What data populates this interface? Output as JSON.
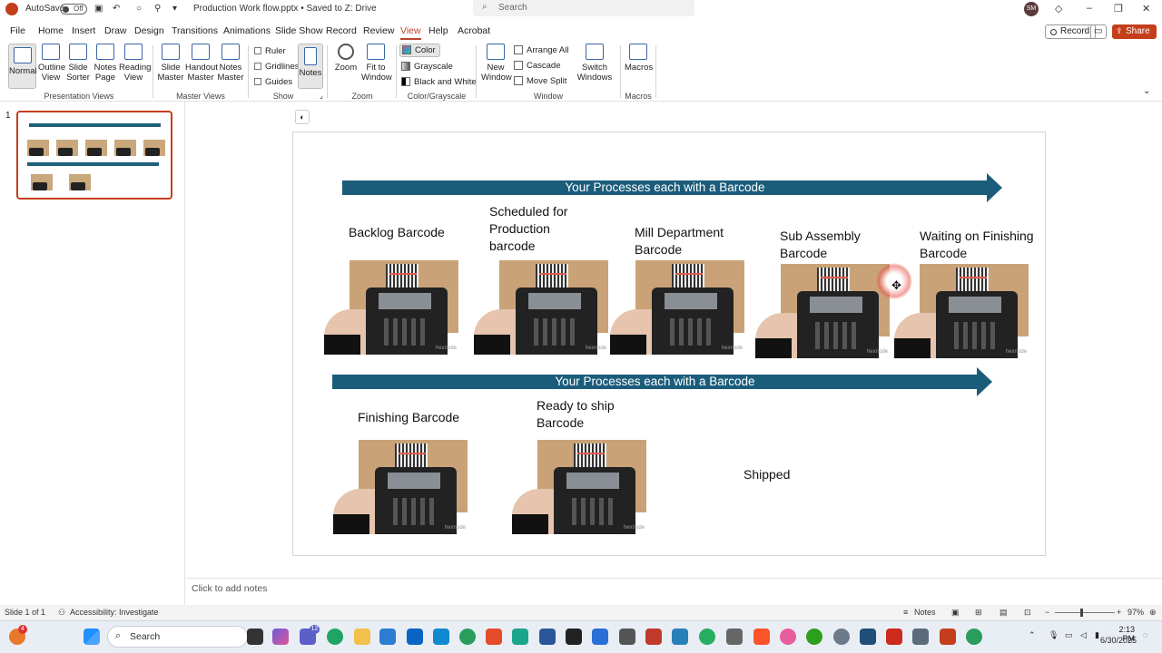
{
  "titlebar": {
    "autosave_label": "AutoSave",
    "autosave_state": "Off",
    "document_title": "Production Work flow.pptx • Saved to Z: Drive",
    "search_placeholder": "Search",
    "user_initials": "SM"
  },
  "menu": {
    "items": [
      "File",
      "Home",
      "Insert",
      "Draw",
      "Design",
      "Transitions",
      "Animations",
      "Slide Show",
      "Record",
      "Review",
      "View",
      "Help",
      "Acrobat"
    ],
    "active": "View",
    "record_button": "Record",
    "share_button": "Share"
  },
  "ribbon": {
    "presentation_views": {
      "label": "Presentation Views",
      "buttons": [
        "Normal",
        "Outline View",
        "Slide Sorter",
        "Notes Page",
        "Reading View"
      ]
    },
    "master_views": {
      "label": "Master Views",
      "buttons": [
        "Slide Master",
        "Handout Master",
        "Notes Master"
      ]
    },
    "show": {
      "label": "Show",
      "checkboxes": [
        "Ruler",
        "Gridlines",
        "Guides"
      ],
      "notes_button": "Notes"
    },
    "zoom": {
      "label": "Zoom",
      "buttons": [
        "Zoom",
        "Fit to Window"
      ]
    },
    "color_grayscale": {
      "label": "Color/Grayscale",
      "options": [
        "Color",
        "Grayscale",
        "Black and White"
      ],
      "selected": "Color"
    },
    "window": {
      "label": "Window",
      "new_window": "New Window",
      "options": [
        "Arrange All",
        "Cascade",
        "Move Split"
      ],
      "switch_windows": "Switch Windows"
    },
    "macros": {
      "label": "Macros",
      "button": "Macros"
    }
  },
  "thumbnails": {
    "slide_number": "1"
  },
  "slide": {
    "arrow_top": "Your Processes each with a Barcode",
    "arrow_bottom": "Your Processes each with a Barcode",
    "steps_row1": [
      "Backlog Barcode",
      "Scheduled for Production barcode",
      "Mill Department Barcode",
      "Sub Assembly Barcode",
      "Waiting on Finishing Barcode"
    ],
    "steps_row2": [
      "Finishing Barcode",
      "Ready to ship Barcode"
    ],
    "final_step": "Shipped",
    "image_watermark": "hexnode"
  },
  "notes": {
    "placeholder": "Click to add notes"
  },
  "statusbar": {
    "slide_indicator": "Slide 1 of 1",
    "accessibility": "Accessibility: Investigate",
    "notes_button": "Notes",
    "zoom_level": "97%"
  },
  "taskbar": {
    "search_label": "Search",
    "time": "2:13 PM",
    "date": "6/30/2025",
    "teams_badge": "12",
    "notification_badge": "4"
  }
}
